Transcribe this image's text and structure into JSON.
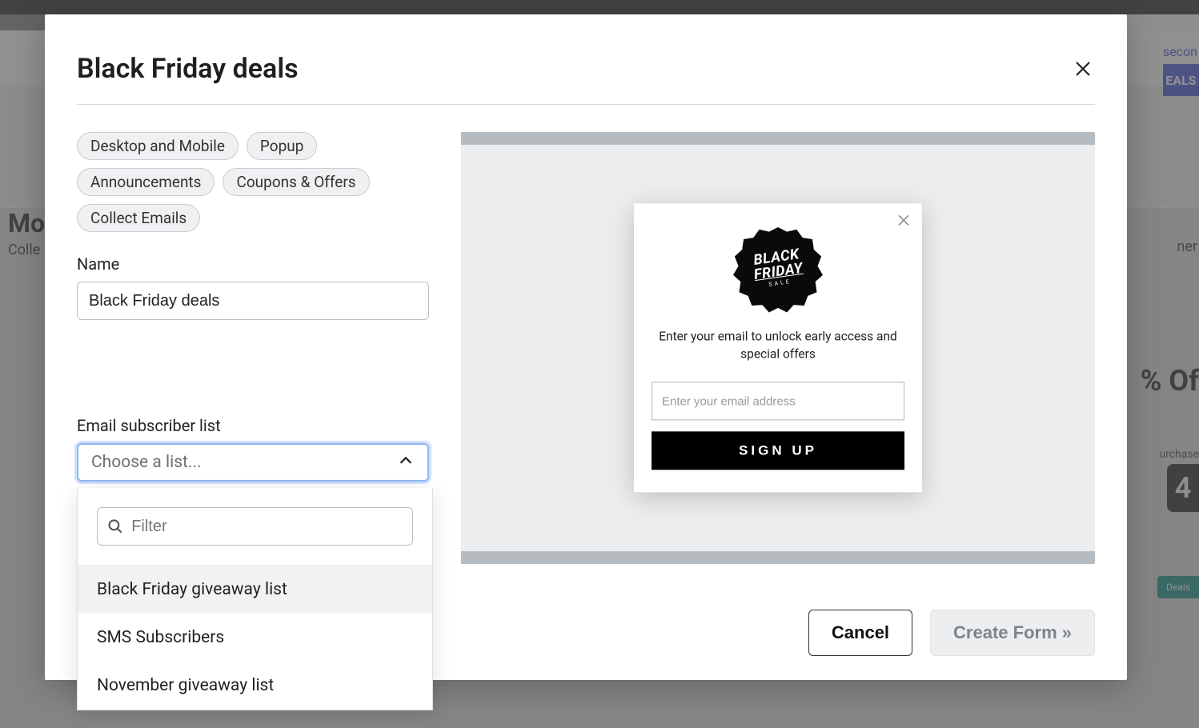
{
  "background": {
    "top_right_link_fragment": "secon",
    "top_right_box": "EALS",
    "mo": "Mo",
    "colle": "Colle",
    "ner": "ner",
    "pct": "% Of",
    "urchas": "urchase",
    "num": "4",
    "deals_btn": "Deals"
  },
  "modal": {
    "title": "Black Friday deals",
    "tags": [
      "Desktop and Mobile",
      "Popup",
      "Announcements",
      "Coupons & Offers",
      "Collect Emails"
    ],
    "name_label": "Name",
    "name_value": "Black Friday deals",
    "list_label": "Email subscriber list",
    "list_placeholder": "Choose a list...",
    "filter_placeholder": "Filter",
    "options": [
      "Black Friday giveaway list",
      "SMS Subscribers",
      "November giveaway list"
    ],
    "preview": {
      "badge_line1": "BLACK",
      "badge_line2": "FRIDAY",
      "badge_line3": "SALE",
      "text": "Enter your email to unlock early access and special offers",
      "email_placeholder": "Enter your email address",
      "signup_label": "SIGN UP"
    },
    "footer": {
      "cancel": "Cancel",
      "create": "Create Form »"
    }
  }
}
